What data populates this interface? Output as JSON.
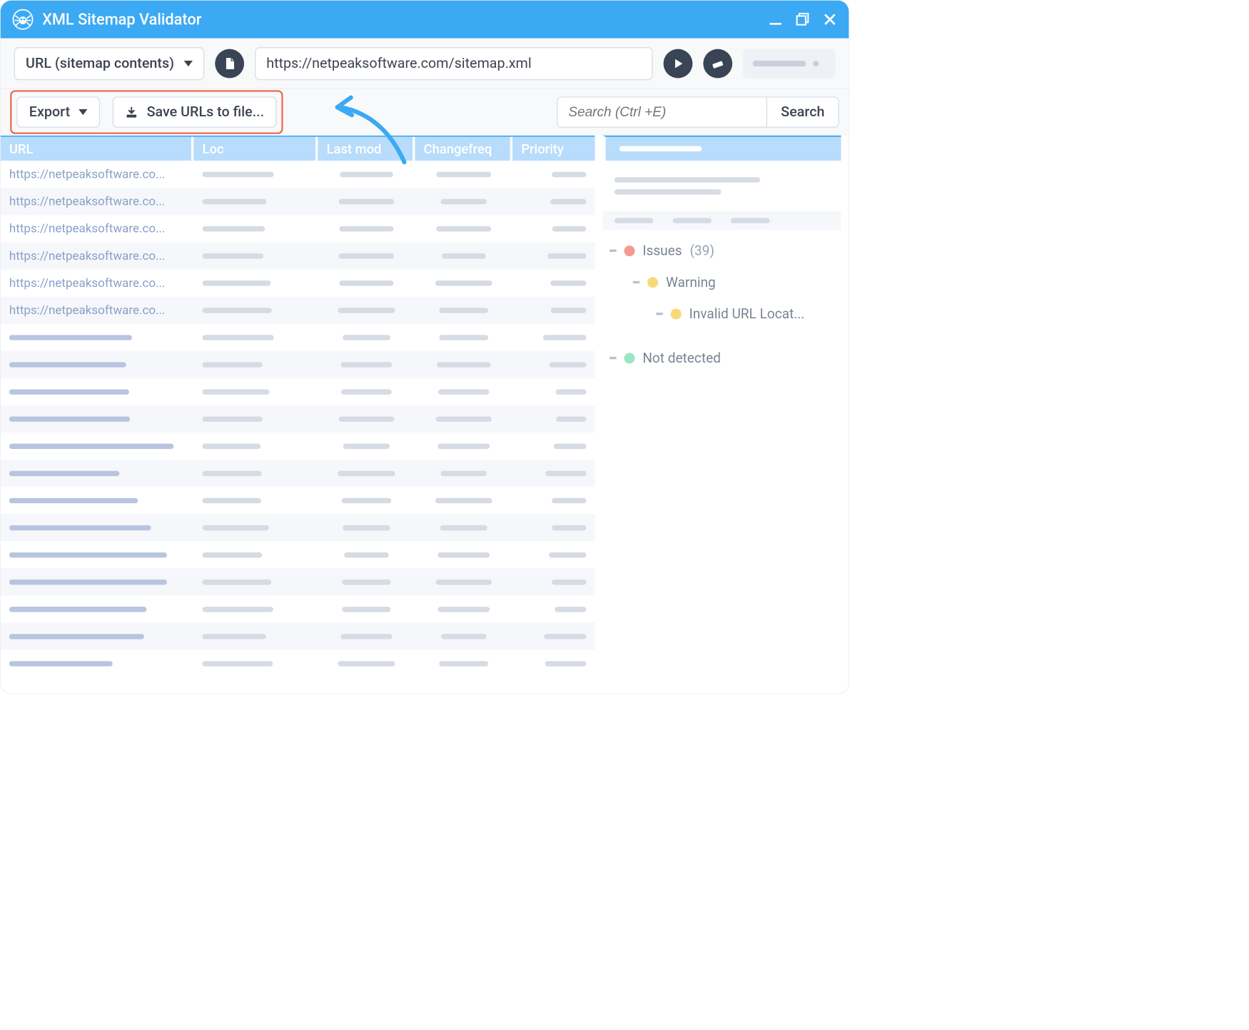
{
  "titlebar": {
    "title": "XML Sitemap Validator"
  },
  "toolbar1": {
    "mode_label": "URL (sitemap contents)",
    "url_value": "https://netpeaksoftware.com/sitemap.xml"
  },
  "toolbar2": {
    "export_label": "Export",
    "save_label": "Save URLs to file...",
    "search_placeholder": "Search (Ctrl +E)",
    "search_button": "Search"
  },
  "table": {
    "columns": {
      "url": "URL",
      "loc": "Loc",
      "lastmod": "Last mod",
      "changefreq": "Changefreq",
      "priority": "Priority"
    },
    "rows": [
      {
        "url": "https://netpeaksoftware.co..."
      },
      {
        "url": "https://netpeaksoftware.co..."
      },
      {
        "url": "https://netpeaksoftware.co..."
      },
      {
        "url": "https://netpeaksoftware.co..."
      },
      {
        "url": "https://netpeaksoftware.co..."
      },
      {
        "url": "https://netpeaksoftware.co..."
      },
      {
        "url": ""
      },
      {
        "url": ""
      },
      {
        "url": ""
      },
      {
        "url": ""
      },
      {
        "url": ""
      },
      {
        "url": ""
      },
      {
        "url": ""
      },
      {
        "url": ""
      },
      {
        "url": ""
      },
      {
        "url": ""
      },
      {
        "url": ""
      },
      {
        "url": ""
      },
      {
        "url": ""
      }
    ]
  },
  "sidebar": {
    "issues_label": "Issues",
    "issues_count": "(39)",
    "warning_label": "Warning",
    "invalid_url_label": "Invalid URL Locat...",
    "not_detected_label": "Not detected"
  }
}
